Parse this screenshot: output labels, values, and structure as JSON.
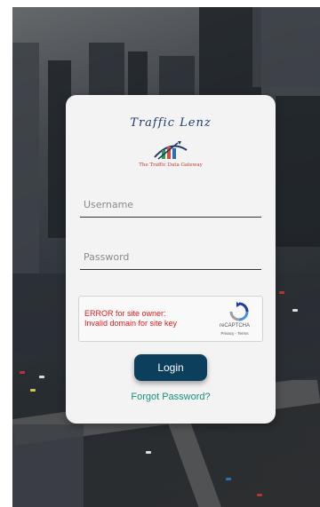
{
  "logo": {
    "title": "Traffic Lenz",
    "tagline": "The Traffic Data Gateway"
  },
  "form": {
    "username_placeholder": "Username",
    "password_placeholder": "Password",
    "login_label": "Login",
    "forgot_label": "Forgot Password?"
  },
  "recaptcha": {
    "error_line1": "ERROR for site owner:",
    "error_line2": "Invalid domain for site key",
    "brand": "reCAPTCHA",
    "links": "Privacy - Terms"
  },
  "colors": {
    "button": "#0b3f5c",
    "link": "#17907a",
    "error": "#e01b1b",
    "card": "#f3f3f3"
  }
}
